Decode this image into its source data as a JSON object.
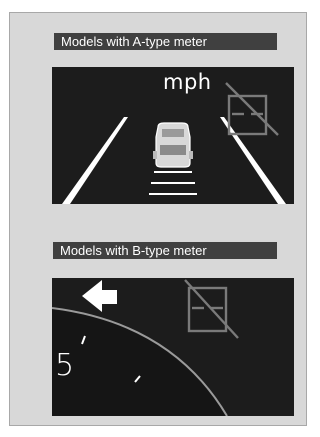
{
  "section_a": {
    "label": "Models with A-type meter",
    "unit": "mph",
    "icon": "lane-keeping-off-icon"
  },
  "section_b": {
    "label": "Models with B-type meter",
    "speedo_digit": "5",
    "icons": [
      "left-arrow-icon",
      "lane-keeping-off-icon"
    ]
  },
  "colors": {
    "panel_bg": "#d8d8d8",
    "label_bg": "#404040",
    "screen_bg": "#1c1c1c",
    "icon_gray": "#7a7a7a"
  }
}
